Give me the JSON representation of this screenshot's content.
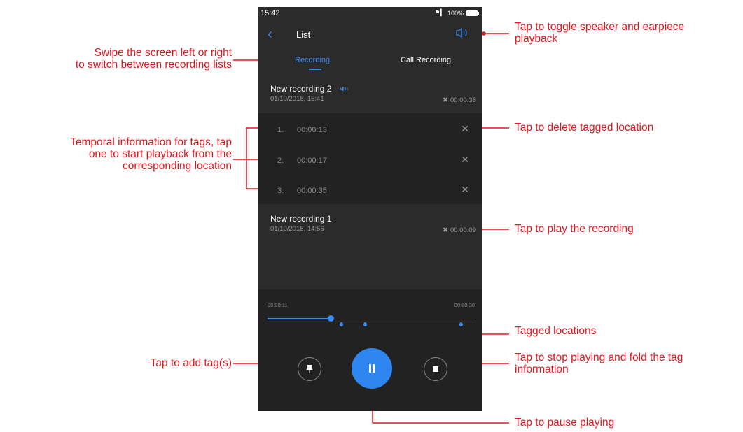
{
  "status_bar": {
    "time": "15:42",
    "signal": "⚲ .││",
    "battery": "100%"
  },
  "header": {
    "title": "List"
  },
  "tabs": [
    {
      "label": "Recording",
      "active": true
    },
    {
      "label": "Call Recording",
      "active": false
    }
  ],
  "recordings": [
    {
      "name": "New recording 2",
      "date": "01/10/2018, 15:41",
      "duration": "00:00:38",
      "expanded": true
    },
    {
      "name": "New recording 1",
      "date": "01/10/2018, 14:56",
      "duration": "00:00:09",
      "expanded": false
    }
  ],
  "tags": [
    {
      "index": "1.",
      "time": "00:00:13"
    },
    {
      "index": "2.",
      "time": "00:00:17"
    },
    {
      "index": "3.",
      "time": "00:00:35"
    }
  ],
  "player": {
    "elapsed": "00:00:11",
    "total": "00:00:38",
    "progress": 0.29,
    "tag_positions": [
      0.342,
      0.447,
      0.921
    ]
  },
  "annotations": {
    "swipe": [
      "Swipe the screen left or right",
      "to switch between recording lists"
    ],
    "temporal": [
      "Temporal information for tags, tap",
      "one to start playback from the",
      "corresponding location"
    ],
    "add_tag": "Tap to add tag(s)",
    "speaker": [
      "Tap to toggle speaker and earpiece",
      "playback"
    ],
    "delete_tag": "Tap to delete tagged location",
    "play_recording": "Tap to play the recording",
    "tagged_locations": "Tagged locations",
    "stop": [
      "Tap to stop playing and fold the tag",
      "information"
    ],
    "pause": "Tap to pause playing"
  },
  "colors": {
    "accent": "#2f86f0",
    "annotation": "#e8141c",
    "phone_bg": "#2b2b2b"
  }
}
